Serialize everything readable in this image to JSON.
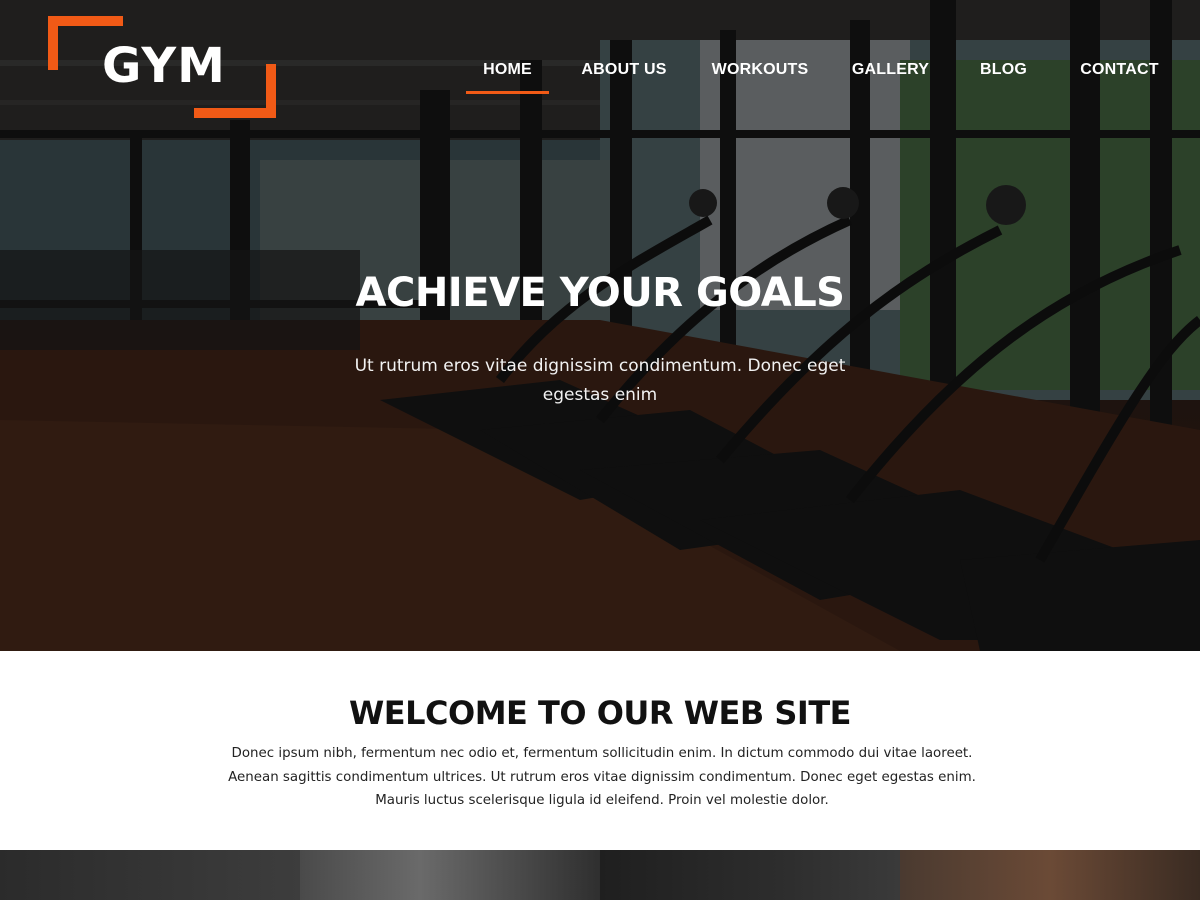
{
  "logo": {
    "text": "GYM"
  },
  "nav": {
    "items": [
      {
        "label": "HOME",
        "active": true
      },
      {
        "label": "ABOUT US",
        "active": false
      },
      {
        "label": "WORKOUTS",
        "active": false
      },
      {
        "label": "GALLERY",
        "active": false
      },
      {
        "label": "BLOG",
        "active": false
      },
      {
        "label": "CONTACT",
        "active": false
      }
    ]
  },
  "hero": {
    "title": "ACHIEVE YOUR GOALS",
    "subtitle": "Ut rutrum eros vitae dignissim condimentum. Donec eget egestas enim",
    "image_description": "gym-treadmills-photo"
  },
  "welcome": {
    "title": "WELCOME TO OUR WEB SITE",
    "text": "Donec ipsum nibh, fermentum nec odio et, fermentum sollicitudin enim. In dictum commodo dui vitae laoreet. Aenean sagittis condimentum ultrices. Ut rutrum eros vitae dignissim condimentum. Donec eget egestas enim. Mauris luctus scelerisque ligula id eleifend. Proin vel molestie dolor."
  },
  "colors": {
    "accent": "#f15a16",
    "hero_text": "#ffffff",
    "body_text": "#222222"
  }
}
